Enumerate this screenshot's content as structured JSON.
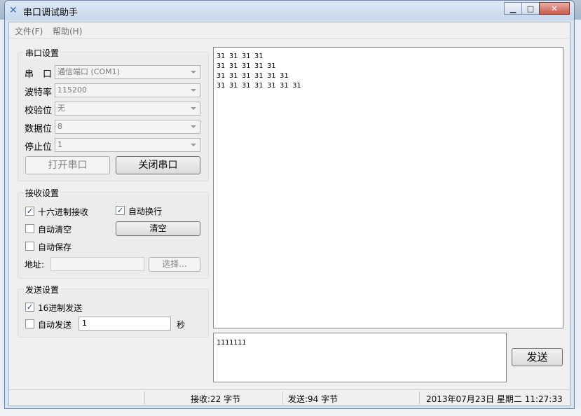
{
  "window": {
    "title": "串口调试助手"
  },
  "menu": [
    {
      "label": "文件(F)"
    },
    {
      "label": "帮助(H)"
    }
  ],
  "serial": {
    "group_title": "串口设置",
    "port_label": "串　口",
    "port_value": "通信端口 (COM1)",
    "baud_label": "波特率",
    "baud_value": "115200",
    "parity_label": "校验位",
    "parity_value": "无",
    "databits_label": "数据位",
    "databits_value": "8",
    "stopbits_label": "停止位",
    "stopbits_value": "1",
    "open_label": "打开串口",
    "close_label": "关闭串口"
  },
  "receive": {
    "group_title": "接收设置",
    "hex_label": "十六进制接收",
    "hex_checked": true,
    "autowrap_label": "自动换行",
    "autowrap_checked": true,
    "autoclear_label": "自动清空",
    "autoclear_checked": false,
    "clear_label": "清空",
    "autosave_label": "自动保存",
    "autosave_checked": false,
    "address_label": "地址:",
    "address_value": "",
    "browse_label": "选择..."
  },
  "send": {
    "group_title": "发送设置",
    "hex_label": "16进制发送",
    "hex_checked": true,
    "autosend_label": "自动发送",
    "autosend_checked": false,
    "interval_value": "1",
    "interval_unit": "秒",
    "send_button": "发送",
    "input_text": "1111111"
  },
  "rx_display": {
    "lines": [
      "31 31 31 31",
      "31 31 31 31 31",
      "31 31 31 31 31 31",
      "31 31 31 31 31 31 31"
    ]
  },
  "status": {
    "received": "接收:22 字节",
    "sent": "发送:94 字节",
    "datetime": "2013年07月23日 星期二 11:27:33"
  },
  "colors": {
    "title_bar": "#c6d8ec",
    "close_button": "#c85a4b"
  }
}
